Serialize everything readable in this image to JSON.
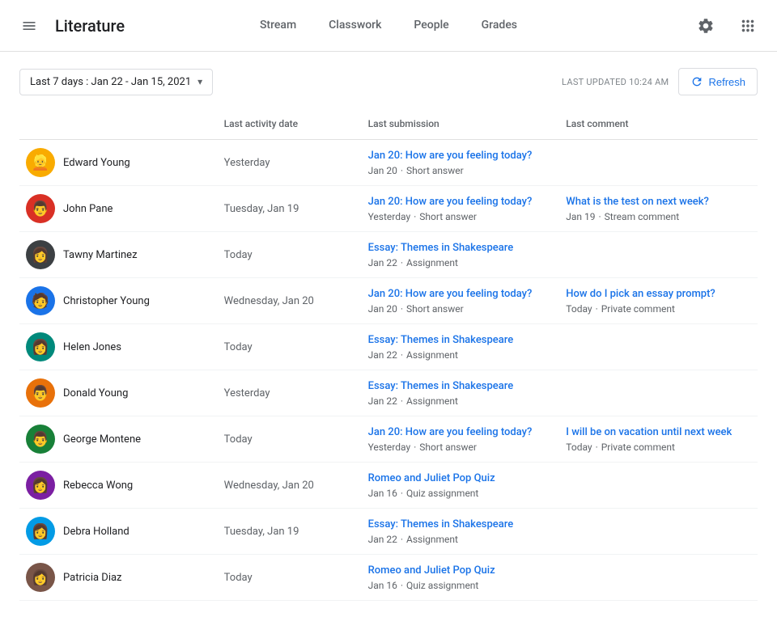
{
  "header": {
    "menu_icon": "☰",
    "title": "Literature",
    "nav": [
      {
        "label": "Stream",
        "active": false
      },
      {
        "label": "Classwork",
        "active": false
      },
      {
        "label": "People",
        "active": false
      },
      {
        "label": "Grades",
        "active": false
      }
    ]
  },
  "toolbar": {
    "date_filter_label": "Last 7 days :  Jan 22 - Jan 15, 2021",
    "last_updated_label": "LAST UPDATED 10:24 AM",
    "refresh_label": "Refresh"
  },
  "table": {
    "columns": [
      {
        "label": ""
      },
      {
        "label": "Last activity date"
      },
      {
        "label": "Last submission"
      },
      {
        "label": "Last comment"
      }
    ],
    "rows": [
      {
        "name": "Edward Young",
        "avatar_color": "av-yellow",
        "avatar_emoji": "👱",
        "activity": "Yesterday",
        "submission_link": "Jan 20: How are you feeling today?",
        "submission_meta_date": "Jan 20",
        "submission_meta_type": "Short answer",
        "comment_link": "",
        "comment_meta_date": "",
        "comment_meta_type": ""
      },
      {
        "name": "John Pane",
        "avatar_color": "av-red",
        "avatar_emoji": "👨",
        "activity": "Tuesday, Jan 19",
        "submission_link": "Jan 20: How are you feeling today?",
        "submission_meta_date": "Yesterday",
        "submission_meta_type": "Short answer",
        "comment_link": "What is the test on next week?",
        "comment_meta_date": "Jan 19",
        "comment_meta_type": "Stream comment"
      },
      {
        "name": "Tawny Martinez",
        "avatar_color": "av-dark",
        "avatar_emoji": "👩",
        "activity": "Today",
        "submission_link": "Essay: Themes in Shakespeare",
        "submission_meta_date": "Jan 22",
        "submission_meta_type": "Assignment",
        "comment_link": "",
        "comment_meta_date": "",
        "comment_meta_type": ""
      },
      {
        "name": "Christopher Young",
        "avatar_color": "av-blue",
        "avatar_emoji": "🧑",
        "activity": "Wednesday, Jan 20",
        "submission_link": "Jan 20: How are you feeling today?",
        "submission_meta_date": "Jan 20",
        "submission_meta_type": "Short answer",
        "comment_link": "How do I pick an essay prompt?",
        "comment_meta_date": "Today",
        "comment_meta_type": "Private comment"
      },
      {
        "name": "Helen Jones",
        "avatar_color": "av-teal",
        "avatar_emoji": "👩",
        "activity": "Today",
        "submission_link": "Essay: Themes in Shakespeare",
        "submission_meta_date": "Jan 22",
        "submission_meta_type": "Assignment",
        "comment_link": "",
        "comment_meta_date": "",
        "comment_meta_type": ""
      },
      {
        "name": "Donald Young",
        "avatar_color": "av-orange",
        "avatar_emoji": "👨",
        "activity": "Yesterday",
        "submission_link": "Essay: Themes in Shakespeare",
        "submission_meta_date": "Jan 22",
        "submission_meta_type": "Assignment",
        "comment_link": "",
        "comment_meta_date": "",
        "comment_meta_type": ""
      },
      {
        "name": "George Montene",
        "avatar_color": "av-green",
        "avatar_emoji": "👨",
        "activity": "Today",
        "submission_link": "Jan 20: How are you feeling today?",
        "submission_meta_date": "Yesterday",
        "submission_meta_type": "Short answer",
        "comment_link": "I will be on vacation until next week",
        "comment_meta_date": "Today",
        "comment_meta_type": "Private comment"
      },
      {
        "name": "Rebecca Wong",
        "avatar_color": "av-purple",
        "avatar_emoji": "👩",
        "activity": "Wednesday, Jan 20",
        "submission_link": "Romeo and Juliet Pop Quiz",
        "submission_meta_date": "Jan 16",
        "submission_meta_type": "Quiz assignment",
        "comment_link": "",
        "comment_meta_date": "",
        "comment_meta_type": ""
      },
      {
        "name": "Debra Holland",
        "avatar_color": "av-lightblue",
        "avatar_emoji": "👩",
        "activity": "Tuesday, Jan 19",
        "submission_link": "Essay: Themes in Shakespeare",
        "submission_meta_date": "Jan 22",
        "submission_meta_type": "Assignment",
        "comment_link": "",
        "comment_meta_date": "",
        "comment_meta_type": ""
      },
      {
        "name": "Patricia Diaz",
        "avatar_color": "av-brown",
        "avatar_emoji": "👩",
        "activity": "Today",
        "submission_link": "Romeo and Juliet Pop Quiz",
        "submission_meta_date": "Jan 16",
        "submission_meta_type": "Quiz assignment",
        "comment_link": "",
        "comment_meta_date": "",
        "comment_meta_type": ""
      }
    ]
  }
}
